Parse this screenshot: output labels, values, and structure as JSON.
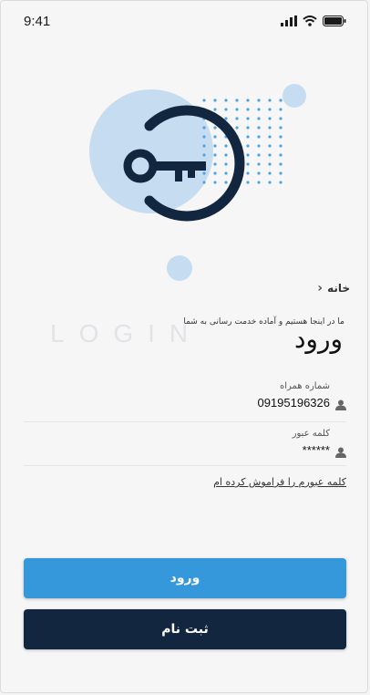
{
  "status_bar": {
    "time": "9:41"
  },
  "breadcrumb": {
    "home_label": "خانه"
  },
  "watermark": {
    "text": "LOGIN"
  },
  "header": {
    "tagline": "ما در اینجا هستیم و آماده خدمت رسانی به شما",
    "title": "ورود"
  },
  "form": {
    "phone": {
      "label": "شماره همراه",
      "value": "09195196326"
    },
    "password": {
      "label": "کلمه عبور",
      "value": "******"
    },
    "forgot_link": "کلمه عبورم را فراموش کرده ام"
  },
  "actions": {
    "login_label": "ورود",
    "register_label": "ثبت نام"
  },
  "colors": {
    "primary": "#3498db",
    "dark": "#13263f",
    "accent_light": "#c6dcf0",
    "dots": "#4ea3e3"
  },
  "icons": [
    "signal-icon",
    "wifi-icon",
    "battery-icon",
    "key-icon",
    "chevron-left-icon",
    "user-icon"
  ]
}
